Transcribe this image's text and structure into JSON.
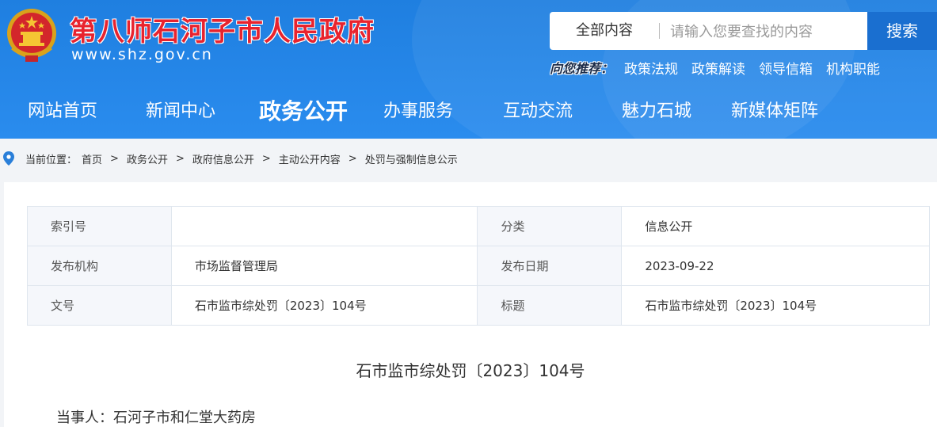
{
  "header": {
    "site_title": "第八师石河子市人民政府",
    "site_url": "www.shz.gov.cn",
    "emblem_icon": "national-emblem-icon",
    "colors": {
      "header_blue": "#2a8cee",
      "title_red": "#e8232e",
      "search_button": "#1a6fd0"
    }
  },
  "search": {
    "scope": "全部内容",
    "placeholder": "请输入您要查找的内容",
    "button_label": "搜索"
  },
  "recommend": {
    "label": "向您推荐：",
    "links": [
      "政策法规",
      "政策解读",
      "领导信箱",
      "机构职能"
    ]
  },
  "nav": {
    "items": [
      "网站首页",
      "新闻中心",
      "政务公开",
      "办事服务",
      "互动交流",
      "魅力石城",
      "新媒体矩阵"
    ],
    "active": "政务公开"
  },
  "breadcrumb": {
    "icon": "location-pin-icon",
    "label": "当前位置：",
    "items": [
      "首页",
      "政务公开",
      "政府信息公开",
      "主动公开内容",
      "处罚与强制信息公示"
    ]
  },
  "meta": {
    "rows": [
      {
        "k1": "索引号",
        "v1": "",
        "k2": "分类",
        "v2": "信息公开"
      },
      {
        "k1": "发布机构",
        "v1": "市场监督管理局",
        "k2": "发布日期",
        "v2": "2023-09-22"
      },
      {
        "k1": "文号",
        "v1": "石市监市综处罚〔2023〕104号",
        "k2": "标题",
        "v2": "石市监市综处罚〔2023〕104号"
      }
    ]
  },
  "document": {
    "title": "石市监市综处罚〔2023〕104号",
    "party": "当事人：石河子市和仁堂大药房"
  }
}
